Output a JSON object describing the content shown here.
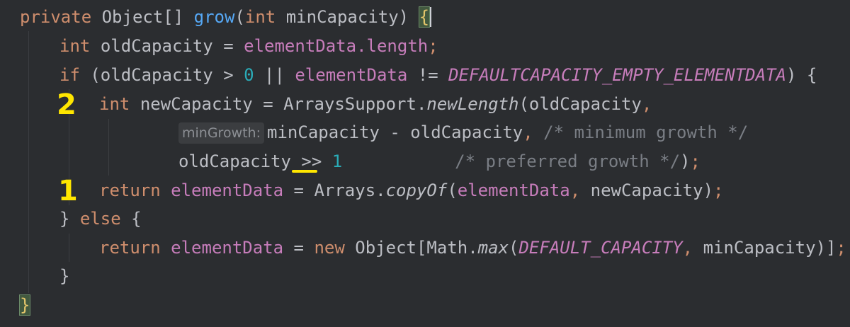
{
  "code": {
    "line1": {
      "kw_private": "private",
      "type": "Object[]",
      "method": "grow",
      "open_paren": "(",
      "kw_int": "int",
      "param": "minCapacity",
      "close_paren": ")",
      "brace": "{"
    },
    "line2": {
      "kw_int": "int",
      "var": "oldCapacity",
      "eq": "=",
      "field": "elementData",
      "rest": ".length",
      "semi": ";"
    },
    "line3": {
      "kw_if": "if",
      "cond_a": "(oldCapacity > ",
      "zero": "0",
      "cond_b": " || ",
      "field": "elementData",
      "ne": " != ",
      "const": "DEFAULTCAPACITY_EMPTY_ELEMENTDATA",
      "cond_end": ") {"
    },
    "line4": {
      "kw_int": "int",
      "rest_a": "newCapacity = ArraysSupport.",
      "method": "newLength",
      "rest_b": "(oldCapacity",
      "comma": ","
    },
    "line5": {
      "hint": "minGrowth:",
      "rest": "minCapacity - oldCapacity",
      "comma": ",",
      "comment": "/* minimum growth */"
    },
    "line6": {
      "var": "oldCapacity ",
      "op": ">>",
      "num": "1",
      "comment": "/* preferred growth */",
      "close": ")",
      "semi": ";"
    },
    "line7": {
      "kw_return": "return",
      "field": "elementData",
      "eq": " = Arrays.",
      "method": "copyOf",
      "args_open": "(",
      "field2": "elementData",
      "comma": ",",
      "args_rest": " newCapacity)",
      "semi": ";"
    },
    "line8": {
      "brace": "} ",
      "kw_else": "else",
      "open": " {"
    },
    "line9": {
      "kw_return": "return",
      "field": "elementData",
      "eq": " = ",
      "kw_new": "new",
      "type": " Object[Math.",
      "method": "max",
      "open": "(",
      "const": "DEFAULT_CAPACITY",
      "comma": ",",
      "rest": " minCapacity)]",
      "semi": ";"
    },
    "line10": {
      "brace": "}"
    },
    "line11": {
      "brace": "}"
    }
  },
  "annotations": {
    "mark_2": "2",
    "mark_1": "1"
  },
  "colors": {
    "background": "#2b2d30",
    "annotation": "#ffe600",
    "keyword": "#cf8e6d",
    "method": "#56a8f5",
    "field": "#c77dbb",
    "number": "#2aacb8",
    "comment": "#7a7e85"
  }
}
